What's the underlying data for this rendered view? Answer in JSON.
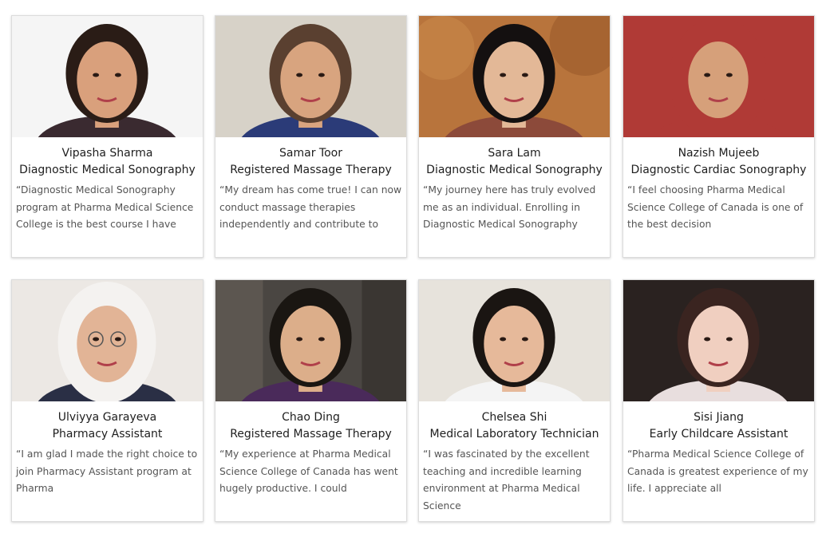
{
  "testimonials": [
    {
      "name": "Vipasha Sharma",
      "program": "Diagnostic Medical Sonography",
      "quote": "“Diagnostic Medical Sonography program at Pharma Medical Science College is the best course I have",
      "photo": {
        "bg": "#f5f5f5",
        "hair": "#2a1c16",
        "skin": "#d9a07c",
        "shirt": "#3a2a30"
      }
    },
    {
      "name": "Samar Toor",
      "program": "Registered Massage Therapy",
      "quote": "“My dream has come true! I can now conduct massage therapies independently and contribute to",
      "photo": {
        "bg": "#d7d2c8",
        "hair": "#5a4030",
        "skin": "#d8a47f",
        "shirt": "#2b3b78"
      }
    },
    {
      "name": "Sara Lam",
      "program": "Diagnostic Medical Sonography",
      "quote": "“My journey here has truly evolved me as an individual. Enrolling in Diagnostic Medical Sonography",
      "photo": {
        "bg": "#b8743c",
        "hair": "#141010",
        "skin": "#e3b897",
        "shirt": "#8c4a3a"
      }
    },
    {
      "name": "Nazish Mujeeb",
      "program": "Diagnostic Cardiac Sonography",
      "quote": "“I feel choosing Pharma Medical Science College of Canada is one of the best decision",
      "photo": {
        "bg": "#b03a36",
        "hair": "#b03a36",
        "skin": "#d6a07a",
        "shirt": "#b03a36"
      }
    },
    {
      "name": "Ulviyya Garayeva",
      "program": "Pharmacy Assistant",
      "quote": "“I am glad I made the right choice to join Pharmacy Assistant program at Pharma",
      "photo": {
        "bg": "#ece8e4",
        "hair": "#f4f2f0",
        "skin": "#e2b496",
        "shirt": "#2a2f45"
      }
    },
    {
      "name": "Chao Ding",
      "program": "Registered Massage Therapy",
      "quote": "“My experience at Pharma Medical Science College of Canada has went hugely productive. I could",
      "photo": {
        "bg": "#4a4642",
        "hair": "#1a1612",
        "skin": "#dcae8a",
        "shirt": "#4a2a5a"
      }
    },
    {
      "name": "Chelsea Shi",
      "program": "Medical Laboratory Technician",
      "quote": "“I was fascinated by the excellent teaching and incredible learning environment at Pharma Medical Science",
      "photo": {
        "bg": "#e7e3dc",
        "hair": "#1a1512",
        "skin": "#e6b99a",
        "shirt": "#f4f4f4"
      }
    },
    {
      "name": "Sisi Jiang",
      "program": "Early Childcare Assistant",
      "quote": "“Pharma Medical Science College of Canada is greatest experience of my life. I appreciate all",
      "photo": {
        "bg": "#2a2220",
        "hair": "#3a2420",
        "skin": "#f0cfc0",
        "shirt": "#e8dede"
      }
    }
  ]
}
